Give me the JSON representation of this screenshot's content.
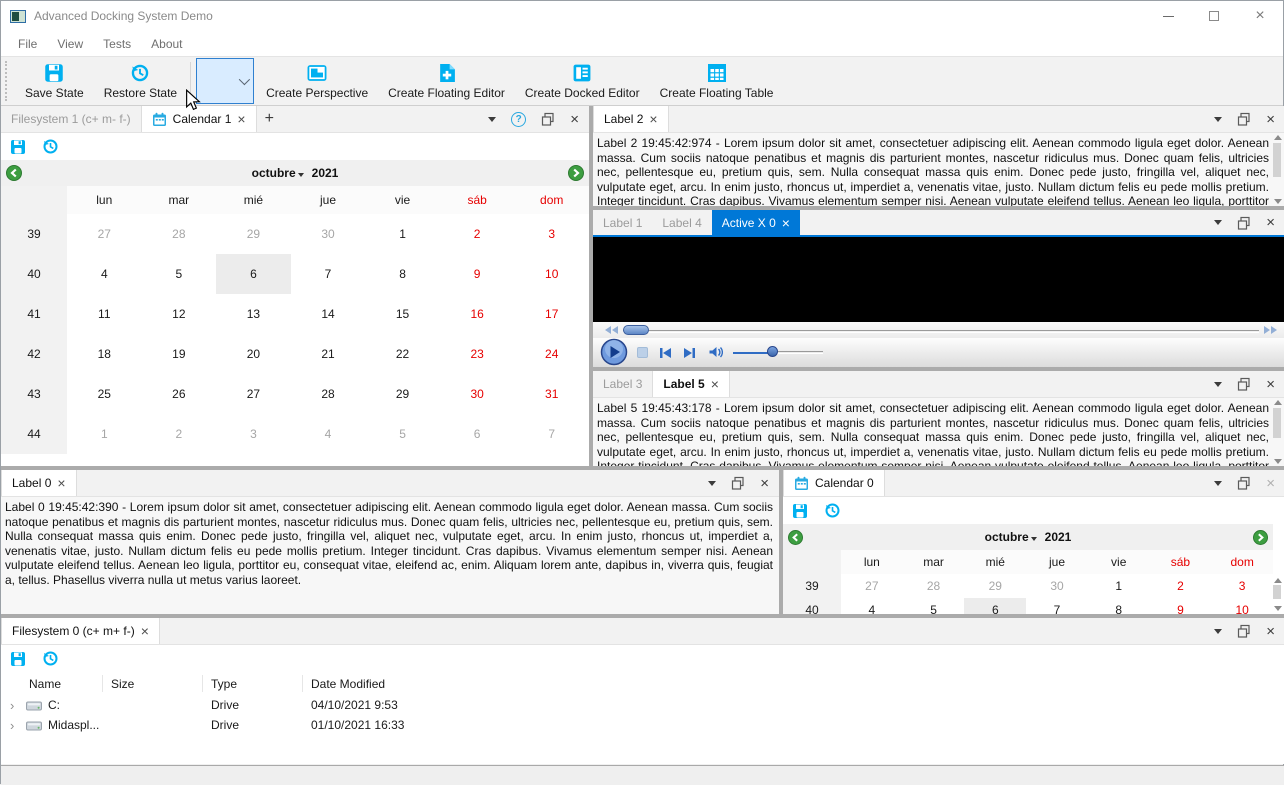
{
  "window": {
    "title": "Advanced Docking System Demo"
  },
  "menu": {
    "items": [
      "File",
      "View",
      "Tests",
      "About"
    ]
  },
  "toolbar": {
    "save_state": "Save State",
    "restore_state": "Restore State",
    "create_perspective": "Create Perspective",
    "create_floating_editor": "Create Floating Editor",
    "create_docked_editor": "Create Docked Editor",
    "create_floating_table": "Create Floating Table",
    "perspective_combo_value": ""
  },
  "colors": {
    "accent_cyan": "#00b0f0",
    "active_tab_blue": "#0078d7",
    "weekend_red": "#e60000",
    "other_month_gray": "#a6a6a6",
    "nav_arrow_green": "#3d9e41"
  },
  "cal1_panel": {
    "tab_filesystem": "Filesystem 1 (c+ m- f-)",
    "tab_calendar": "Calendar 1",
    "add_tab": "+"
  },
  "label2_panel": {
    "tab": "Label 2",
    "text": "Label 2 19:45:42:974 - Lorem ipsum dolor sit amet, consectetuer adipiscing elit. Aenean commodo ligula eget dolor. Aenean massa. Cum sociis natoque penatibus et magnis dis parturient montes, nascetur ridiculus mus. Donec quam felis, ultricies nec, pellentesque eu, pretium quis, sem. Nulla consequat massa quis enim. Donec pede justo, fringilla vel, aliquet nec, vulputate eget, arcu. In enim justo, rhoncus ut, imperdiet a, venenatis vitae, justo. Nullam dictum felis eu pede mollis pretium. Integer tincidunt. Cras dapibus. Vivamus elementum semper nisi. Aenean vulputate eleifend tellus. Aenean leo ligula, porttitor eu, consequat vitae, eleifend ac, enim. Aliquam"
  },
  "activex_panel": {
    "tab1": "Label 1",
    "tab2": "Label 4",
    "tab3": "Active X 0"
  },
  "label5_panel": {
    "tab1": "Label 3",
    "tab2": "Label 5",
    "text": "Label 5 19:45:43:178 - Lorem ipsum dolor sit amet, consectetuer adipiscing elit. Aenean commodo ligula eget dolor. Aenean massa. Cum sociis natoque penatibus et magnis dis parturient montes, nascetur ridiculus mus. Donec quam felis, ultricies nec, pellentesque eu, pretium quis, sem. Nulla consequat massa quis enim. Donec pede justo, fringilla vel, aliquet nec, vulputate eget, arcu. In enim justo, rhoncus ut, imperdiet a, venenatis vitae, justo. Nullam dictum felis eu pede mollis pretium. Integer tincidunt. Cras dapibus. Vivamus elementum semper nisi. Aenean vulputate eleifend tellus. Aenean leo ligula, porttitor eu, consequat vitae, eleifend ac, enim. Aliquam"
  },
  "label0_panel": {
    "tab": "Label 0",
    "text": "Label 0 19:45:42:390 - Lorem ipsum dolor sit amet, consectetuer adipiscing elit. Aenean commodo ligula eget dolor. Aenean massa. Cum sociis natoque penatibus et magnis dis parturient montes, nascetur ridiculus mus. Donec quam felis, ultricies nec, pellentesque eu, pretium quis, sem. Nulla consequat massa quis enim. Donec pede justo, fringilla vel, aliquet nec, vulputate eget, arcu. In enim justo, rhoncus ut, imperdiet a, venenatis vitae, justo. Nullam dictum felis eu pede mollis pretium. Integer tincidunt. Cras dapibus. Vivamus elementum semper nisi. Aenean vulputate eleifend tellus. Aenean leo ligula, porttitor eu, consequat vitae, eleifend ac, enim. Aliquam lorem ante, dapibus in, viverra quis, feugiat a, tellus. Phasellus viverra nulla ut metus varius laoreet."
  },
  "cal0_panel": {
    "tab": "Calendar 0"
  },
  "fs0_panel": {
    "tab": "Filesystem 0 (c+ m+ f-)",
    "columns": [
      "Name",
      "Size",
      "Type",
      "Date Modified"
    ],
    "rows": [
      {
        "name": "C:",
        "size": "",
        "type": "Drive",
        "modified": "04/10/2021 9:53"
      },
      {
        "name": "Midaspl...",
        "size": "",
        "type": "Drive",
        "modified": "01/10/2021 16:33"
      }
    ]
  },
  "calendar": {
    "month": "octubre",
    "year": "2021",
    "day_headers": [
      "lun",
      "mar",
      "mié",
      "jue",
      "vie",
      "sáb",
      "dom"
    ],
    "weeks": [
      {
        "num": "39",
        "days": [
          [
            "27",
            "out"
          ],
          [
            "28",
            "out"
          ],
          [
            "29",
            "out"
          ],
          [
            "30",
            "out"
          ],
          [
            "1",
            "day"
          ],
          [
            "2",
            "wkd"
          ],
          [
            "3",
            "wkd"
          ]
        ]
      },
      {
        "num": "40",
        "days": [
          [
            "4",
            "day"
          ],
          [
            "5",
            "day"
          ],
          [
            "6",
            "sel"
          ],
          [
            "7",
            "day"
          ],
          [
            "8",
            "day"
          ],
          [
            "9",
            "wkd"
          ],
          [
            "10",
            "wkd"
          ]
        ]
      },
      {
        "num": "41",
        "days": [
          [
            "11",
            "day"
          ],
          [
            "12",
            "day"
          ],
          [
            "13",
            "day"
          ],
          [
            "14",
            "day"
          ],
          [
            "15",
            "day"
          ],
          [
            "16",
            "wkd"
          ],
          [
            "17",
            "wkd"
          ]
        ]
      },
      {
        "num": "42",
        "days": [
          [
            "18",
            "day"
          ],
          [
            "19",
            "day"
          ],
          [
            "20",
            "day"
          ],
          [
            "21",
            "day"
          ],
          [
            "22",
            "day"
          ],
          [
            "23",
            "wkd"
          ],
          [
            "24",
            "wkd"
          ]
        ]
      },
      {
        "num": "43",
        "days": [
          [
            "25",
            "day"
          ],
          [
            "26",
            "day"
          ],
          [
            "27",
            "day"
          ],
          [
            "28",
            "day"
          ],
          [
            "29",
            "day"
          ],
          [
            "30",
            "wkd"
          ],
          [
            "31",
            "wkd"
          ]
        ]
      },
      {
        "num": "44",
        "days": [
          [
            "1",
            "out"
          ],
          [
            "2",
            "out"
          ],
          [
            "3",
            "out"
          ],
          [
            "4",
            "out"
          ],
          [
            "5",
            "out"
          ],
          [
            "6",
            "out"
          ],
          [
            "7",
            "out"
          ]
        ]
      }
    ]
  },
  "statusbar": {
    "text": ""
  }
}
